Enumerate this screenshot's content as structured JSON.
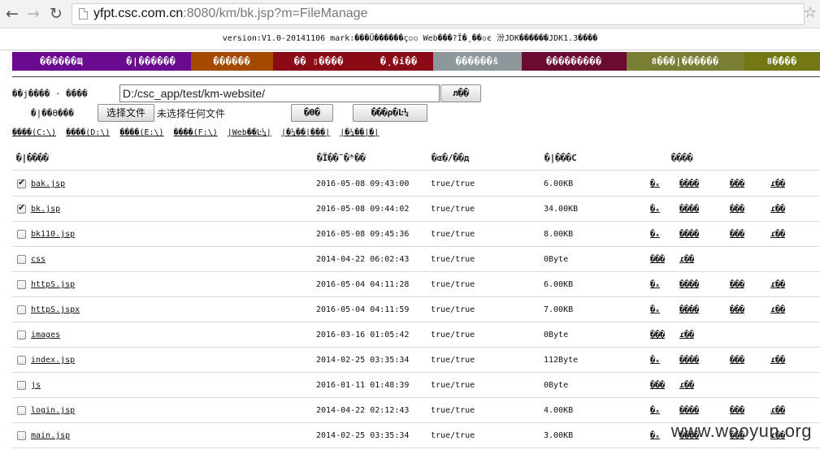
{
  "browser": {
    "url_host": "yfpt.csc.com.cn",
    "url_rest": ":8080/km/bk.jsp?m=FileManage"
  },
  "version_line": "version:V1.0-20141106 mark:���Ü������ç▫▫ Web���?Ï�¸��▫є 汾JDK������JDK1.3����",
  "menu": [
    {
      "label": "������Щ",
      "color": "#6a0a8e"
    },
    {
      "label": "�|������",
      "color": "#6a0a8e"
    },
    {
      "label": "������",
      "color": "#a44a00"
    },
    {
      "label": "�� ▯����",
      "color": "#8a0b15"
    },
    {
      "label": "�¸�i��",
      "color": "#8a0b15"
    },
    {
      "label": "������ŝ",
      "color": "#8e979b"
    },
    {
      "label": "���������",
      "color": "#6b0b31"
    },
    {
      "label": "ȣ���|������",
      "color": "#7a7e34"
    },
    {
      "label": "ȣ�̄���",
      "color": "#737814"
    }
  ],
  "path_label": "��j���� · ����",
  "path_value": "D:/csc_app/test/km-website/",
  "go_button": "л��",
  "upload_label": "�|��ϴ���",
  "choose_file_button": "选择文件",
  "no_file_text": "未选择任何文件",
  "upload_button": "�ϴ�",
  "new_dir_button": "���ρ�Ŀ¼",
  "drives": [
    "����(C:\\)",
    "����(D:\\)",
    "����(E:\\)",
    "����(F:\\)",
    "|Web��Ŀ¼|",
    "|�¼��|���|",
    "|�¼��|�|"
  ],
  "table": {
    "headers": {
      "name": "�|����",
      "mtime": "�Ϊ��¯�ʱ��",
      "rw": "�ɶ�/��д",
      "size": "�|���С",
      "actions": "����"
    },
    "rows": [
      {
        "checked": true,
        "name": "bak.jsp",
        "mtime": "2016-05-08 09:43:00",
        "rw": "true/true",
        "size": "6.00KB",
        "actions": [
          "�ₓ",
          "����",
          "���",
          "ɾ��"
        ]
      },
      {
        "checked": true,
        "name": "bk.jsp",
        "mtime": "2016-05-08 09:44:02",
        "rw": "true/true",
        "size": "34.00KB",
        "actions": [
          "�ₓ",
          "����",
          "���",
          "ɾ��"
        ]
      },
      {
        "checked": false,
        "name": "bk110.jsp",
        "mtime": "2016-05-08 09:45:36",
        "rw": "true/true",
        "size": "8.00KB",
        "actions": [
          "�ₓ",
          "����",
          "���",
          "ɾ��"
        ]
      },
      {
        "checked": false,
        "name": "css",
        "mtime": "2014-04-22 06:02:43",
        "rw": "true/true",
        "size": "0Byte",
        "actions": [
          "���",
          "ɾ��"
        ]
      },
      {
        "checked": false,
        "name": "httpS.jsp",
        "mtime": "2016-05-04 04:11:28",
        "rw": "true/true",
        "size": "6.00KB",
        "actions": [
          "�ₓ",
          "����",
          "���",
          "ɾ��"
        ]
      },
      {
        "checked": false,
        "name": "httpS.jspx",
        "mtime": "2016-05-04 04:11:59",
        "rw": "true/true",
        "size": "7.00KB",
        "actions": [
          "�ₓ",
          "����",
          "���",
          "ɾ��"
        ]
      },
      {
        "checked": false,
        "name": "images",
        "mtime": "2016-03-16 01:05:42",
        "rw": "true/true",
        "size": "0Byte",
        "actions": [
          "���",
          "ɾ��"
        ]
      },
      {
        "checked": false,
        "name": "index.jsp",
        "mtime": "2014-02-25 03:35:34",
        "rw": "true/true",
        "size": "112Byte",
        "actions": [
          "�ₓ",
          "����",
          "���",
          "ɾ��"
        ]
      },
      {
        "checked": false,
        "name": "js",
        "mtime": "2016-01-11 01:48:39",
        "rw": "true/true",
        "size": "0Byte",
        "actions": [
          "���",
          "ɾ��"
        ]
      },
      {
        "checked": false,
        "name": "login.jsp",
        "mtime": "2014-04-22 02:12:43",
        "rw": "true/true",
        "size": "4.00KB",
        "actions": [
          "�ₓ",
          "����",
          "���",
          "ɾ��"
        ]
      },
      {
        "checked": false,
        "name": "main.jsp",
        "mtime": "2014-02-25 03:35:34",
        "rw": "true/true",
        "size": "3.00KB",
        "actions": [
          "�ₓ",
          "����",
          "���",
          "ɾ��"
        ]
      }
    ]
  },
  "watermark": "www.wooyun.org"
}
